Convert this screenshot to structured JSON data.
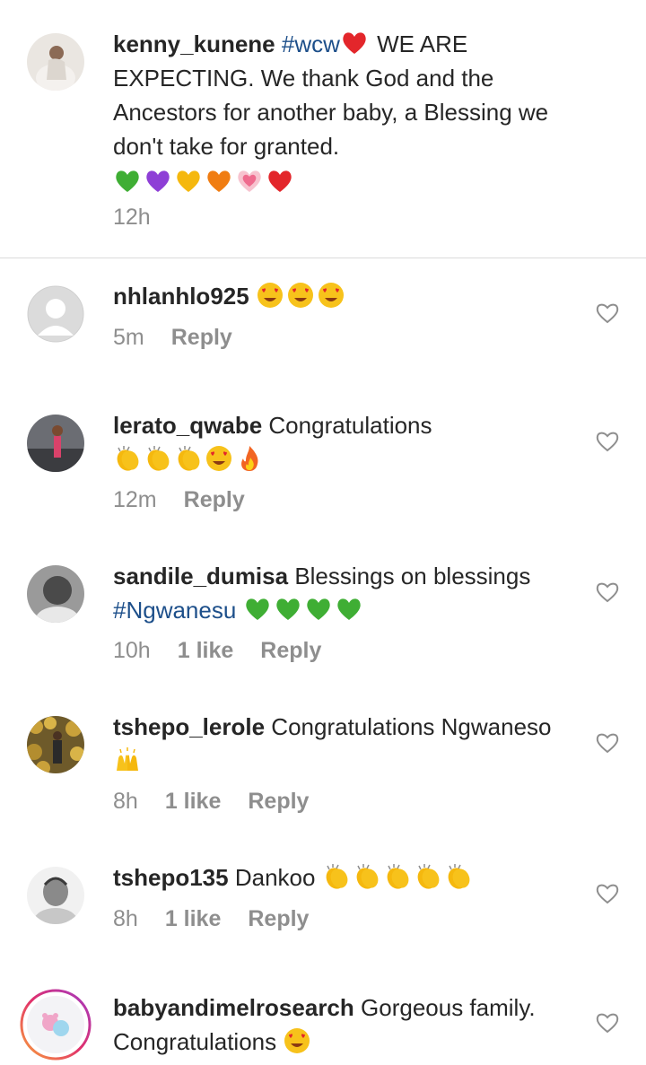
{
  "caption": {
    "username": "kenny_kunene",
    "hashtag": "#wcw",
    "text_part1": "WE ARE EXPECTING. We thank God and the Ancestors for another baby, a Blessing we don't take for granted.",
    "time": "12h",
    "emojis": [
      "green-heart",
      "purple-heart",
      "yellow-heart",
      "orange-heart",
      "growing-heart",
      "red-heart"
    ]
  },
  "comments": [
    {
      "username": "nhlanhlo925",
      "text": "",
      "emojis": [
        "heart-eyes",
        "heart-eyes",
        "heart-eyes"
      ],
      "time": "5m",
      "likes": "",
      "reply": "Reply"
    },
    {
      "username": "lerato_qwabe",
      "text": "Congratulations",
      "emojis": [
        "clap",
        "clap",
        "clap",
        "heart-eyes",
        "fire"
      ],
      "time": "12m",
      "likes": "",
      "reply": "Reply"
    },
    {
      "username": "sandile_dumisa",
      "text": "Blessings on blessings",
      "hashtag": "#Ngwanesu",
      "emojis": [
        "green-heart",
        "green-heart",
        "green-heart",
        "green-heart"
      ],
      "time": "10h",
      "likes": "1 like",
      "reply": "Reply"
    },
    {
      "username": "tshepo_lerole",
      "text": "Congratulations Ngwaneso",
      "emojis": [
        "raised-hands"
      ],
      "time": "8h",
      "likes": "1 like",
      "reply": "Reply"
    },
    {
      "username": "tshepo135",
      "text": "Dankoo",
      "emojis": [
        "clap",
        "clap",
        "clap",
        "clap",
        "clap"
      ],
      "time": "8h",
      "likes": "1 like",
      "reply": "Reply"
    },
    {
      "username": "babyandimelrosearch",
      "text": "Gorgeous family. Congratulations",
      "emojis": [
        "heart-eyes"
      ],
      "time": "",
      "likes": "",
      "reply": ""
    }
  ],
  "colors": {
    "text": "#262626",
    "meta": "#8e8e8e",
    "hashtag": "#1d4f8a",
    "divider": "#dbdbdb"
  }
}
